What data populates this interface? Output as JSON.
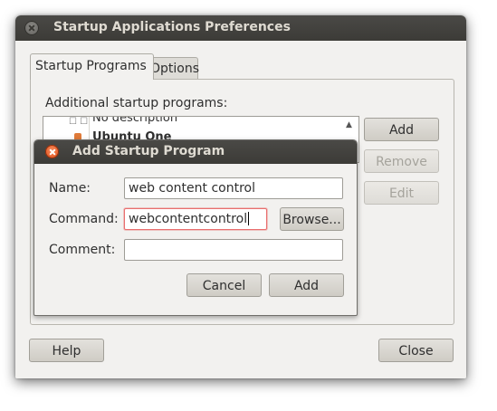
{
  "window": {
    "title": "Startup Applications Preferences"
  },
  "tabs": [
    {
      "label": "Startup Programs",
      "active": true
    },
    {
      "label": "Options",
      "active": false
    }
  ],
  "startup_programs": {
    "list_label": "Additional startup programs:",
    "items": [
      {
        "name": "No description",
        "partially_visible": true
      },
      {
        "name": "Ubuntu One",
        "partially_visible": true
      }
    ],
    "add_label": "Add",
    "remove_label": "Remove",
    "edit_label": "Edit"
  },
  "footer": {
    "help_label": "Help",
    "close_label": "Close"
  },
  "dialog": {
    "title": "Add Startup Program",
    "name_label": "Name:",
    "name_value": "web content control",
    "command_label": "Command:",
    "command_value": "webcontentcontrol",
    "browse_label": "Browse...",
    "comment_label": "Comment:",
    "comment_value": "",
    "cancel_label": "Cancel",
    "add_label": "Add"
  },
  "colors": {
    "titlebar": "#3c3b37",
    "window_bg": "#f2f1ef",
    "close_accent": "#df4b16",
    "focus_border": "#e96e6e"
  }
}
